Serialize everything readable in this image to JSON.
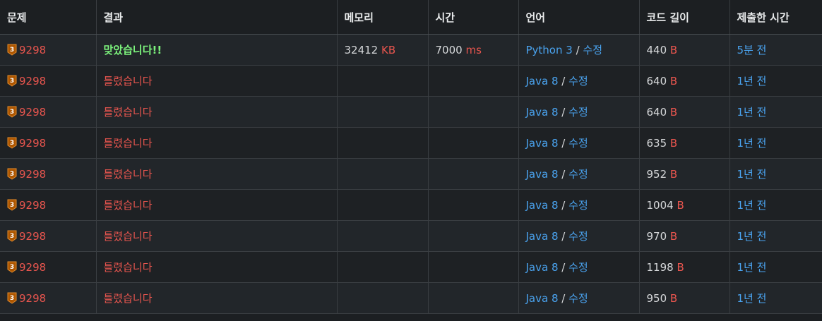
{
  "headers": {
    "problem": "문제",
    "result": "결과",
    "memory": "메모리",
    "time": "시간",
    "language": "언어",
    "code_length": "코드 길이",
    "submitted": "제출한 시간"
  },
  "tier_icon": {
    "name": "bronze-3-tier-icon",
    "number": "3",
    "color": "#ad5600"
  },
  "rows": [
    {
      "problem": "9298",
      "result": "맞았습니다!!",
      "status": "ac",
      "memory_value": "32412",
      "memory_unit": "KB",
      "time_value": "7000",
      "time_unit": "ms",
      "language": "Python 3",
      "separator": "/",
      "edit": "수정",
      "length_value": "440",
      "length_unit": "B",
      "submitted": "5분 전"
    },
    {
      "problem": "9298",
      "result": "틀렸습니다",
      "status": "wa",
      "memory_value": "",
      "memory_unit": "",
      "time_value": "",
      "time_unit": "",
      "language": "Java 8",
      "separator": "/",
      "edit": "수정",
      "length_value": "640",
      "length_unit": "B",
      "submitted": "1년 전"
    },
    {
      "problem": "9298",
      "result": "틀렸습니다",
      "status": "wa",
      "memory_value": "",
      "memory_unit": "",
      "time_value": "",
      "time_unit": "",
      "language": "Java 8",
      "separator": "/",
      "edit": "수정",
      "length_value": "640",
      "length_unit": "B",
      "submitted": "1년 전"
    },
    {
      "problem": "9298",
      "result": "틀렸습니다",
      "status": "wa",
      "memory_value": "",
      "memory_unit": "",
      "time_value": "",
      "time_unit": "",
      "language": "Java 8",
      "separator": "/",
      "edit": "수정",
      "length_value": "635",
      "length_unit": "B",
      "submitted": "1년 전"
    },
    {
      "problem": "9298",
      "result": "틀렸습니다",
      "status": "wa",
      "memory_value": "",
      "memory_unit": "",
      "time_value": "",
      "time_unit": "",
      "language": "Java 8",
      "separator": "/",
      "edit": "수정",
      "length_value": "952",
      "length_unit": "B",
      "submitted": "1년 전"
    },
    {
      "problem": "9298",
      "result": "틀렸습니다",
      "status": "wa",
      "memory_value": "",
      "memory_unit": "",
      "time_value": "",
      "time_unit": "",
      "language": "Java 8",
      "separator": "/",
      "edit": "수정",
      "length_value": "1004",
      "length_unit": "B",
      "submitted": "1년 전"
    },
    {
      "problem": "9298",
      "result": "틀렸습니다",
      "status": "wa",
      "memory_value": "",
      "memory_unit": "",
      "time_value": "",
      "time_unit": "",
      "language": "Java 8",
      "separator": "/",
      "edit": "수정",
      "length_value": "970",
      "length_unit": "B",
      "submitted": "1년 전"
    },
    {
      "problem": "9298",
      "result": "틀렸습니다",
      "status": "wa",
      "memory_value": "",
      "memory_unit": "",
      "time_value": "",
      "time_unit": "",
      "language": "Java 8",
      "separator": "/",
      "edit": "수정",
      "length_value": "1198",
      "length_unit": "B",
      "submitted": "1년 전"
    },
    {
      "problem": "9298",
      "result": "틀렸습니다",
      "status": "wa",
      "memory_value": "",
      "memory_unit": "",
      "time_value": "",
      "time_unit": "",
      "language": "Java 8",
      "separator": "/",
      "edit": "수정",
      "length_value": "950",
      "length_unit": "B",
      "submitted": "1년 전"
    }
  ],
  "colors": {
    "background": "#1c1f22",
    "accepted": "#7cf27c",
    "wrong": "#e8554e",
    "link": "#4aa3ef",
    "unit": "#e8554e"
  }
}
